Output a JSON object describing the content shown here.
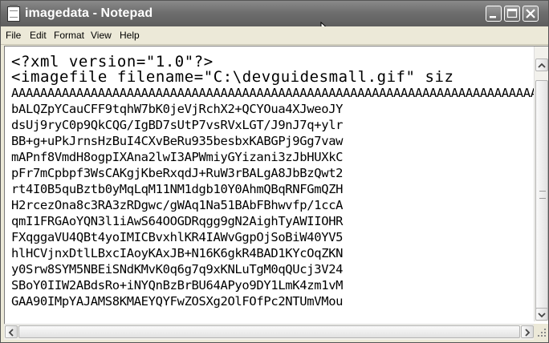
{
  "window": {
    "title": "imagedata - Notepad"
  },
  "menu": [
    "File",
    "Edit",
    "Format",
    "View",
    "Help"
  ],
  "editor": {
    "lines": [
      "<?xml version=\"1.0\"?>",
      "<imagefile filename=\"C:\\devguidesmall.gif\" siz",
      "AAAAAAAAAAAAAAAAAAAAAAAAAAAAAAAAAAAAAAAAAAAAAAAAAAAAAAAAAAAAAAAAAAAAAAAAAAAA",
      "bALQZpYCauCFF9tqhW7bK0jeVjRchX2+QCYOua4XJweoJY",
      "dsUj9ryC0p9QkCQG/IgBD7sUtP7vsRVxLGT/J9nJ7q+ylr",
      "BB+g+uPkJrnsHzBuI4CXvBeRu935besbxKABGPj9Gg7vaw",
      "mAPnf8VmdH8ogpIXAna2lwI3APWmiyGYizani3zJbHUXkC",
      "pFr7mCpbpf3WsCAKgjKbeRxqdJ+RuW3rBALgA8JbBzQwt2",
      "rt4I0B5quBztb0yMqLqM11NM1dgb10Y0AhmQBqRNFGmQZH",
      "H2rcezOna8c3RA3zRDgwc/gWAq1Na51BAbFBhwvfp/1ccA",
      "qmI1FRGAoYQN3l1iAwS64OOGDRqgg9gN2AighTyAWIIOHR",
      "FXqggaVU4QBt4yoIMICBvxhlKR4IAWvGgpOjSoBiW40YV5",
      "hlHCVjnxDtlLBxcIAoyKAxJB+N16K6gkR4BAD1KYcOqZKN",
      "y0Srw8SYM5NBEiSNdKMvK0q6g7q9xKNLuTgM0qQUcj3V24",
      "SBoY0IIW2ABdsRo+iNYQnBzBrBU64APyo9DY1LmK4zm1vM",
      "GAA90IMpYAJAMS8KMAEYQYFwZOSXg2OlFOfPc2NTUmVMou"
    ]
  }
}
